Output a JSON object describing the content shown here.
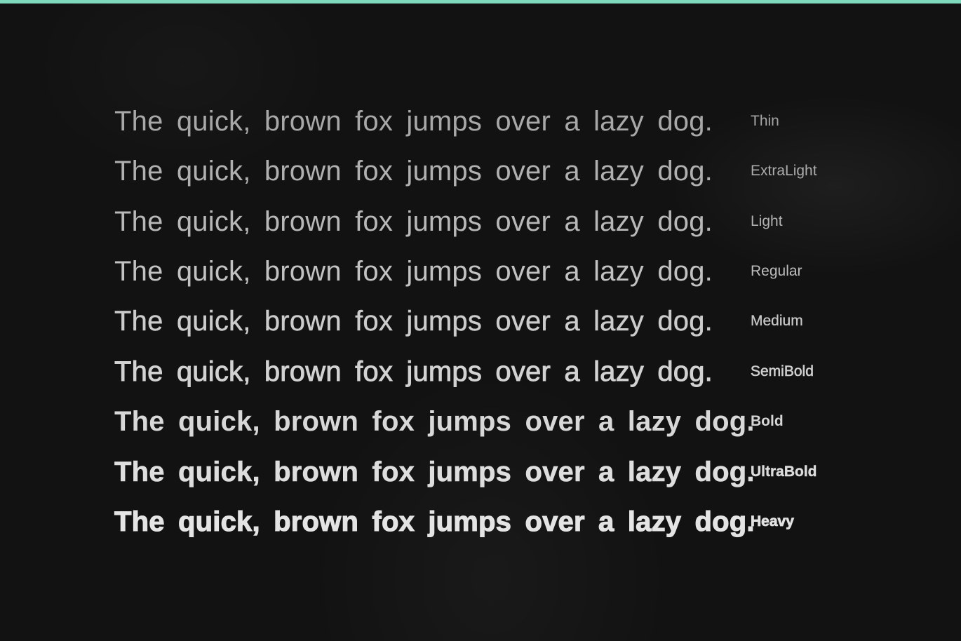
{
  "colors": {
    "background": "#121212",
    "accent_bar": "#7fd9bd",
    "text": "#c7c7c7"
  },
  "specimen": {
    "rows": [
      {
        "sample": "The quick, brown fox jumps over a lazy dog.",
        "weight": "Thin"
      },
      {
        "sample": "The quick, brown fox jumps over a lazy dog.",
        "weight": "ExtraLight"
      },
      {
        "sample": "The quick, brown fox jumps over a lazy dog.",
        "weight": "Light"
      },
      {
        "sample": "The quick, brown fox jumps over a lazy dog.",
        "weight": "Regular"
      },
      {
        "sample": "The quick, brown fox jumps over a lazy dog.",
        "weight": "Medium"
      },
      {
        "sample": "The quick, brown fox jumps over a lazy dog.",
        "weight": "SemiBold"
      },
      {
        "sample": "The quick, brown fox jumps over a lazy dog.",
        "weight": "Bold"
      },
      {
        "sample": "The quick, brown fox jumps over a lazy dog.",
        "weight": "UltraBold"
      },
      {
        "sample": "The quick, brown fox jumps over a lazy dog.",
        "weight": "Heavy"
      }
    ]
  }
}
